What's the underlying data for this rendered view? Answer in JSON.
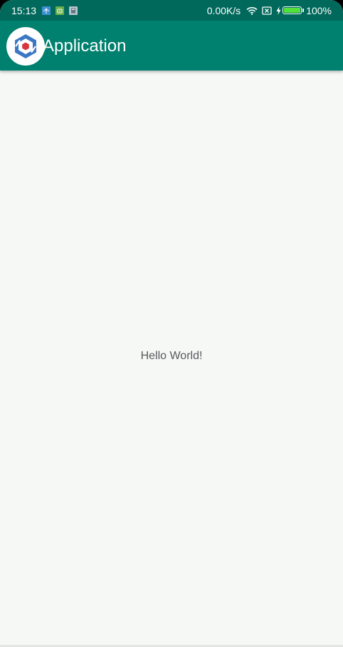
{
  "status_bar": {
    "time": "15:13",
    "network_speed": "0.00K/s",
    "battery_percent_label": "100%",
    "battery_level": 1.0,
    "notification_icons": [
      "usb-debug-icon",
      "android-icon",
      "calculator-icon"
    ],
    "system_icons": [
      "wifi-icon",
      "no-sim-icon",
      "charging-bolt-icon",
      "battery-icon"
    ],
    "colors": {
      "background": "#00695c",
      "battery_fill": "#52e03a"
    }
  },
  "app_bar": {
    "title": "Application",
    "logo_icon": "app-logo-icon",
    "colors": {
      "background": "#00806e",
      "logo_blue": "#3b78c4",
      "logo_red": "#d8363c"
    }
  },
  "main": {
    "message": "Hello World!",
    "colors": {
      "background": "#f6f8f6",
      "text": "#555a5c"
    }
  }
}
